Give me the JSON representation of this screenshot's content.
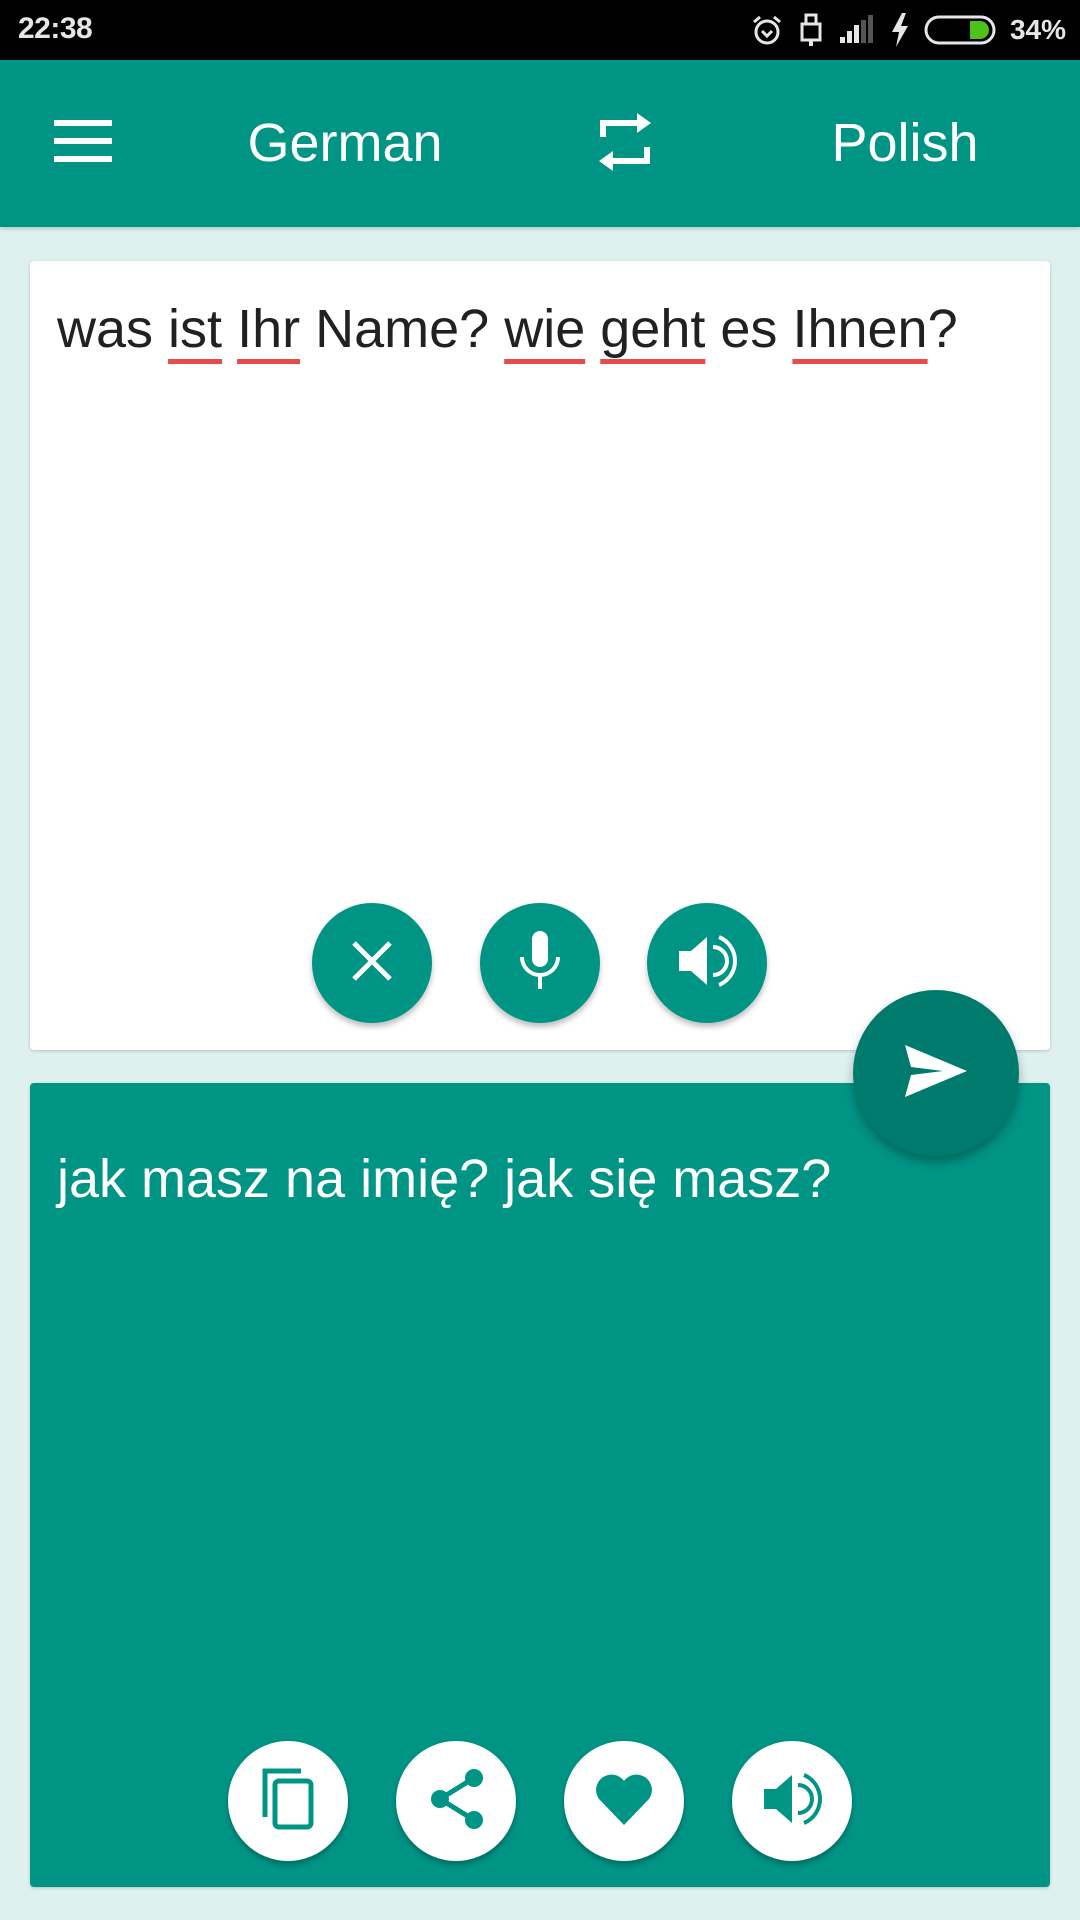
{
  "status_bar": {
    "time": "22:38",
    "battery_percent": "34%",
    "icons": [
      "alarm-icon",
      "lock-icon",
      "signal-icon",
      "charging-icon",
      "battery-icon"
    ]
  },
  "app_bar": {
    "menu_icon": "hamburger-menu-icon",
    "source_language": "German",
    "swap_icon": "swap-languages-icon",
    "target_language": "Polish"
  },
  "input": {
    "words": [
      {
        "text": "was",
        "misspelled": false
      },
      {
        "text": "ist",
        "misspelled": true
      },
      {
        "text": "Ihr",
        "misspelled": true
      },
      {
        "text": "Name?",
        "misspelled": false
      },
      {
        "text": "wie",
        "misspelled": true
      },
      {
        "text": "geht",
        "misspelled": true
      },
      {
        "text": "es",
        "misspelled": false
      },
      {
        "text": "Ihnen",
        "misspelled": true,
        "suffix": "?"
      }
    ],
    "full_text": "was ist Ihr Name? wie geht es Ihnen?",
    "buttons": [
      "clear-icon",
      "microphone-icon",
      "speaker-icon"
    ]
  },
  "translate_button": {
    "icon": "send-icon"
  },
  "output": {
    "text": "jak masz na imię? jak się masz?",
    "buttons": [
      "copy-icon",
      "share-icon",
      "favorite-heart-icon",
      "speaker-icon"
    ]
  },
  "colors": {
    "primary": "#009485",
    "primary_dark": "#007a6d",
    "background": "#dff1ef",
    "spellcheck_underline": "#e84b4b",
    "battery_fill": "#4cc21a"
  }
}
